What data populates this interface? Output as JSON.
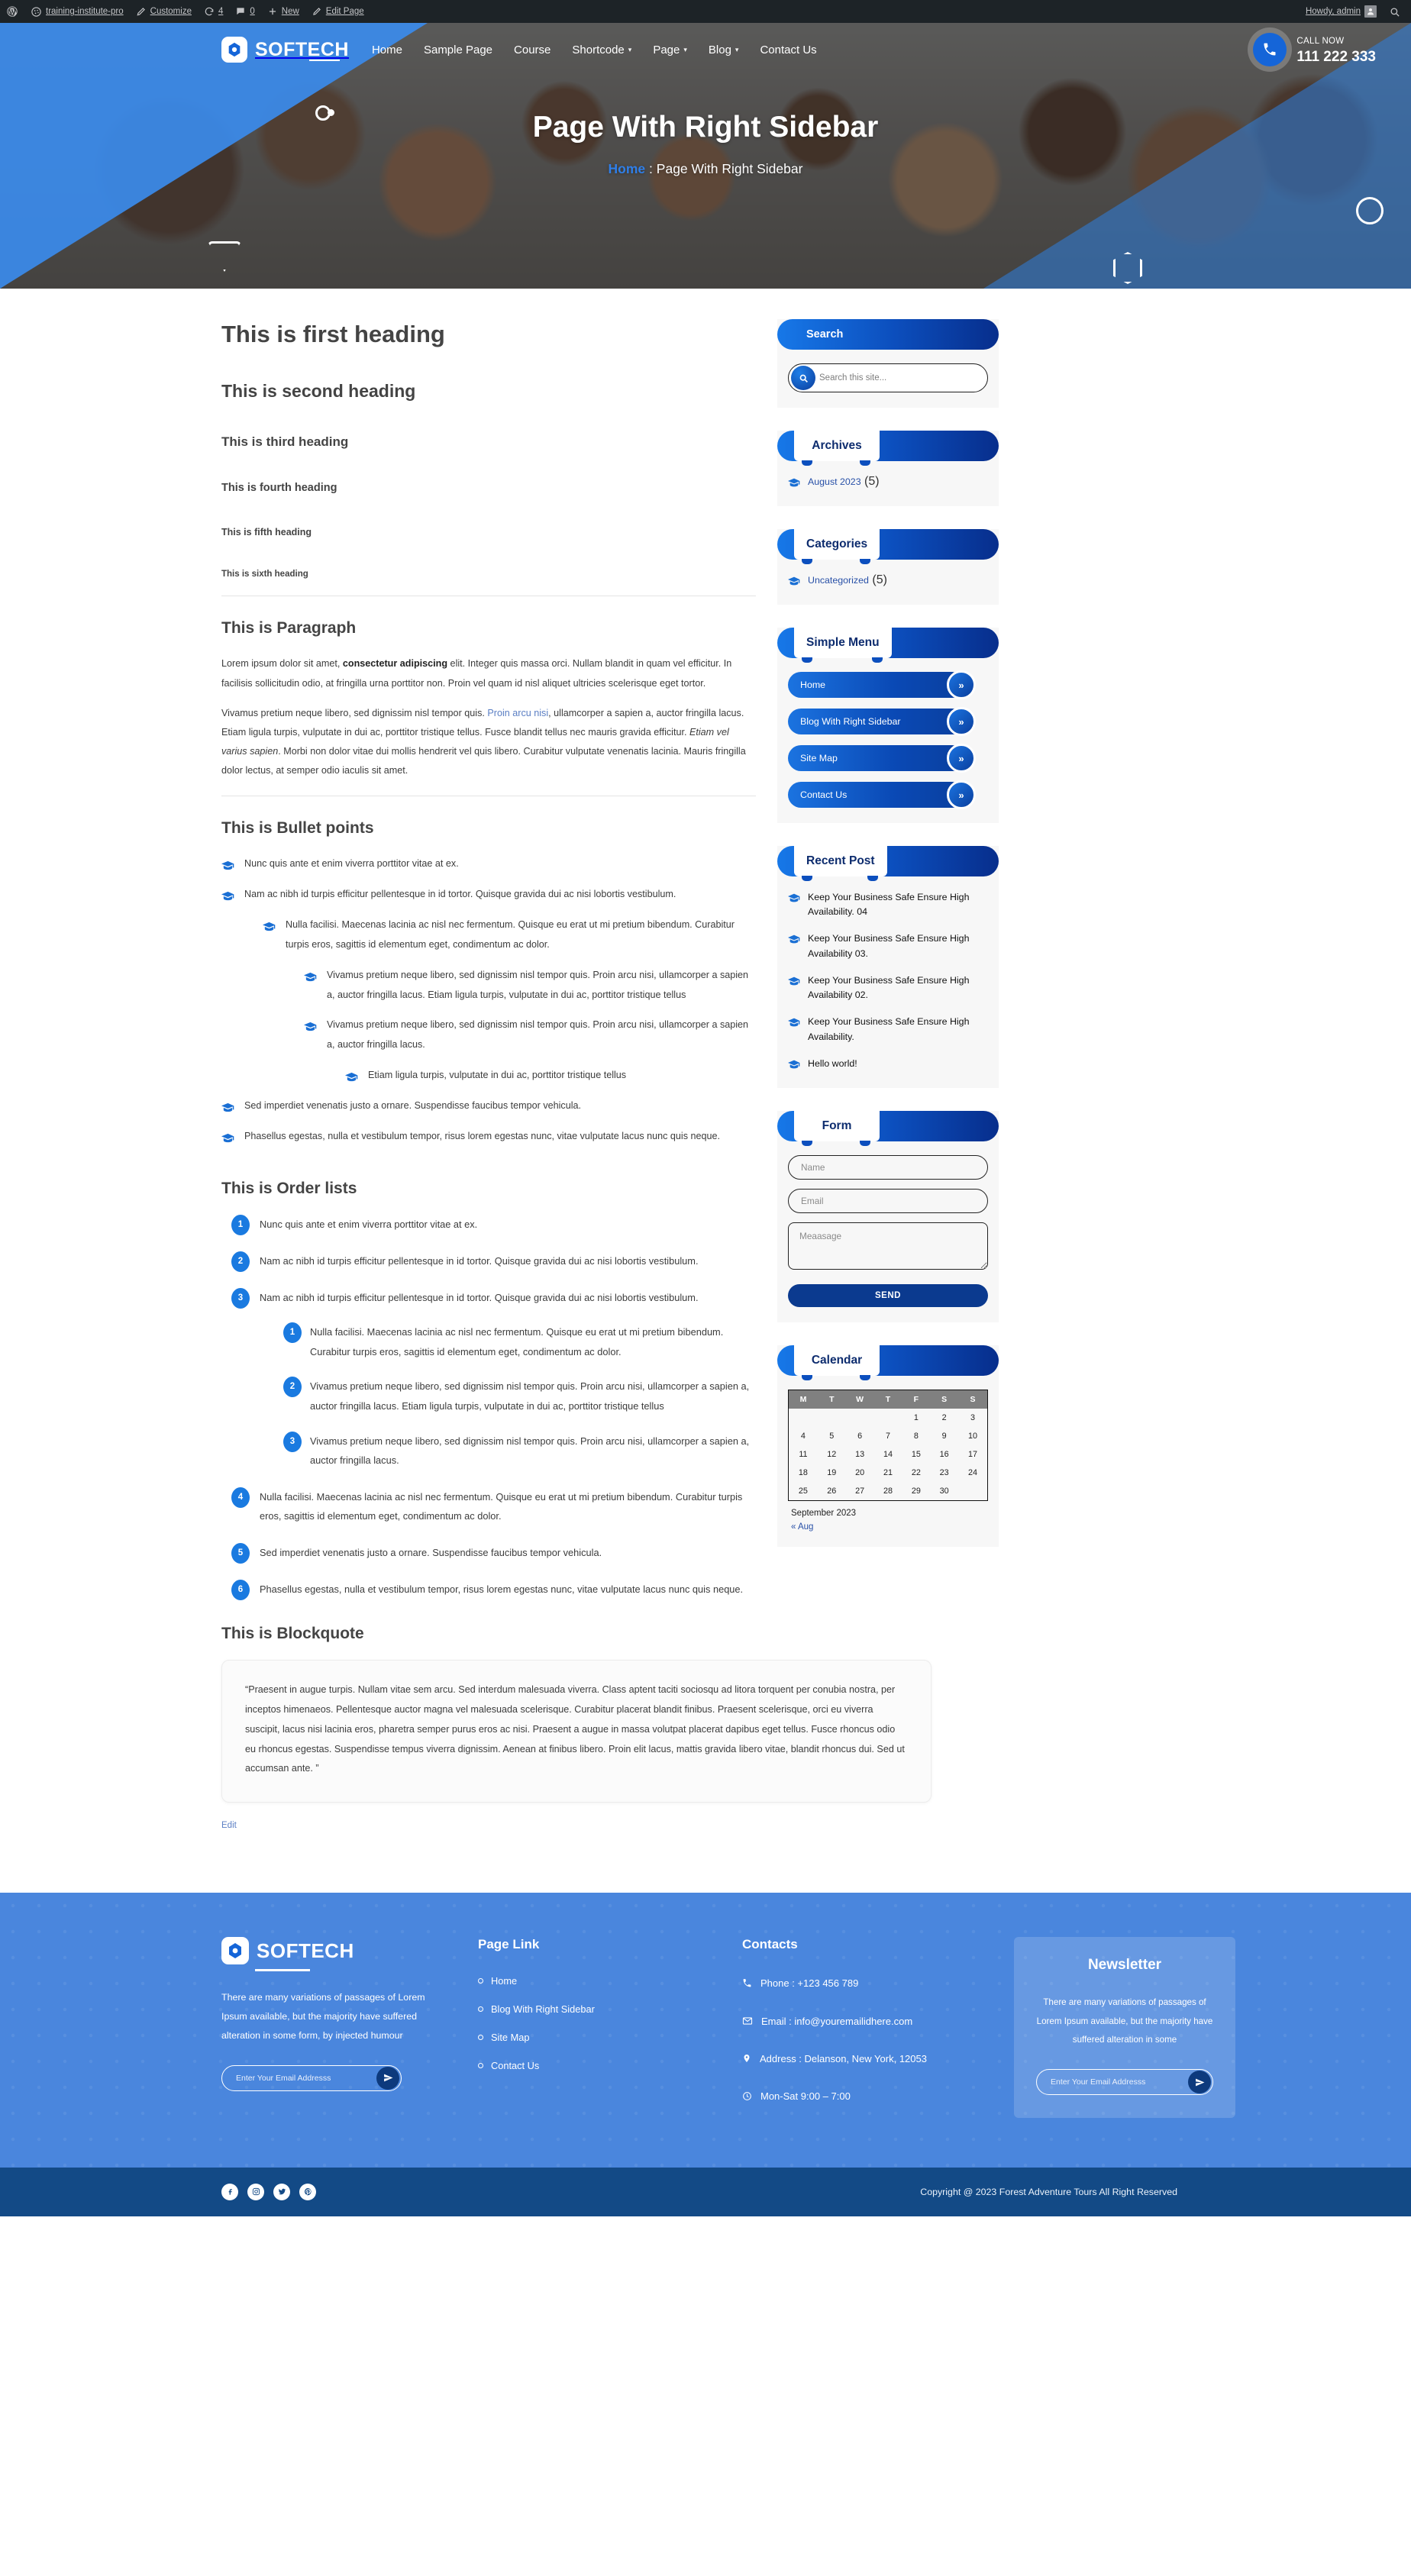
{
  "adminbar": {
    "wp_logo": "wordpress-icon",
    "site_name": "training-institute-pro",
    "customize": "Customize",
    "updates_count": "4",
    "comments_count": "0",
    "new": "New",
    "edit_page": "Edit Page",
    "howdy": "Howdy, admin",
    "search": "search-icon"
  },
  "header": {
    "brand": "SOFTECH",
    "nav": [
      {
        "label": "Home",
        "caret": false
      },
      {
        "label": "Sample Page",
        "caret": false
      },
      {
        "label": "Course",
        "caret": false
      },
      {
        "label": "Shortcode",
        "caret": true
      },
      {
        "label": "Page",
        "caret": true
      },
      {
        "label": "Blog",
        "caret": true
      },
      {
        "label": "Contact Us",
        "caret": false
      }
    ],
    "call_label": "CALL NOW",
    "call_number": "111 222 333",
    "hero_title": "Page With Right Sidebar",
    "crumb_home": "Home",
    "crumb_sep": ":",
    "crumb_current": "Page With Right Sidebar"
  },
  "content": {
    "headings": [
      "This is first heading",
      "This is second heading",
      "This is third heading",
      "This is fourth heading",
      "This is fifth heading",
      "This is sixth heading"
    ],
    "paragraph_title": "This is Paragraph",
    "p1_a": "Lorem ipsum dolor sit amet, ",
    "p1_b": "consectetur adipiscing",
    "p1_c": " elit. Integer quis massa orci. Nullam blandit in quam vel efficitur. In facilisis sollicitudin odio, at fringilla urna porttitor non. Proin vel quam id nisl aliquet ultricies scelerisque eget tortor.",
    "p2_a": "Vivamus pretium neque libero, sed dignissim nisl tempor quis. ",
    "p2_link": "Proin arcu nisi",
    "p2_b": ", ullamcorper a sapien a, auctor fringilla lacus. Etiam ligula turpis, vulputate in dui ac, porttitor tristique tellus. Fusce blandit tellus nec mauris gravida efficitur. ",
    "p2_i": "Etiam vel varius sapien",
    "p2_c": ". Morbi non dolor vitae dui mollis hendrerit vel quis libero. Curabitur vulputate venenatis lacinia. Mauris fringilla dolor lectus, at semper odio iaculis sit amet.",
    "bullet_title": "This is Bullet points",
    "bullets": {
      "b1": "Nunc quis ante et enim viverra porttitor vitae at ex.",
      "b2": "Nam ac nibh id turpis efficitur pellentesque in id tortor. Quisque gravida dui ac nisi lobortis vestibulum.",
      "b2_1": "Nulla facilisi. Maecenas lacinia ac nisl nec fermentum. Quisque eu erat ut mi pretium bibendum. Curabitur turpis eros, sagittis id elementum eget, condimentum ac dolor.",
      "b2_1_1": "Vivamus pretium neque libero, sed dignissim nisl tempor quis. Proin arcu nisi, ullamcorper a sapien a, auctor fringilla lacus. Etiam ligula turpis, vulputate in dui ac, porttitor tristique tellus",
      "b2_1_2": "Vivamus pretium neque libero, sed dignissim nisl tempor quis. Proin arcu nisi, ullamcorper a sapien a, auctor fringilla lacus.",
      "b2_1_2_1": "Etiam ligula turpis, vulputate in dui ac, porttitor tristique tellus",
      "b3": "Sed imperdiet venenatis justo a ornare. Suspendisse faucibus tempor vehicula.",
      "b4": "Phasellus egestas, nulla et vestibulum tempor, risus lorem egestas nunc, vitae vulputate lacus nunc quis neque."
    },
    "order_title": "This is Order lists",
    "orders": {
      "o1": "Nunc quis ante et enim viverra porttitor vitae at ex.",
      "o2": "Nam ac nibh id turpis efficitur pellentesque in id tortor. Quisque gravida dui ac nisi lobortis vestibulum.",
      "o3": "Nam ac nibh id turpis efficitur pellentesque in id tortor. Quisque gravida dui ac nisi lobortis vestibulum.",
      "o3_1": "Nulla facilisi. Maecenas lacinia ac nisl nec fermentum. Quisque eu erat ut mi pretium bibendum. Curabitur turpis eros, sagittis id elementum eget, condimentum ac dolor.",
      "o3_2": "Vivamus pretium neque libero, sed dignissim nisl tempor quis. Proin arcu nisi, ullamcorper a sapien a, auctor fringilla lacus. Etiam ligula turpis, vulputate in dui ac, porttitor tristique tellus",
      "o3_3": "Vivamus pretium neque libero, sed dignissim nisl tempor quis. Proin arcu nisi, ullamcorper a sapien a, auctor fringilla lacus.",
      "o4": "Nulla facilisi. Maecenas lacinia ac nisl nec fermentum. Quisque eu erat ut mi pretium bibendum. Curabitur turpis eros, sagittis id elementum eget, condimentum ac dolor.",
      "o5": "Sed imperdiet venenatis justo a ornare. Suspendisse faucibus tempor vehicula.",
      "o6": "Phasellus egestas, nulla et vestibulum tempor, risus lorem egestas nunc, vitae vulputate lacus nunc quis neque."
    },
    "blockquote_title": "This is Blockquote",
    "blockquote_text": "“Praesent in augue turpis. Nullam vitae sem arcu. Sed interdum malesuada viverra. Class aptent taciti sociosqu ad litora torquent per conubia nostra, per inceptos himenaeos. Pellentesque auctor magna vel malesuada scelerisque. Curabitur placerat blandit finibus. Praesent scelerisque, orci eu viverra suscipit, lacus nisi lacinia eros, pharetra semper purus eros ac nisi. Praesent a augue in massa volutpat placerat dapibus eget tellus. Fusce rhoncus odio eu rhoncus egestas. Suspendisse tempus viverra dignissim. Aenean at finibus libero. Proin elit lacus, mattis gravida libero vitae, blandit rhoncus dui. Sed ut accumsan ante. ”",
    "edit_link": "Edit"
  },
  "sidebar": {
    "search": {
      "title": "Search",
      "placeholder": "Search this site...",
      "icon": "search-icon"
    },
    "archives": {
      "title": "Archives",
      "items": [
        {
          "label": "August 2023",
          "count": "(5)"
        }
      ]
    },
    "categories": {
      "title": "Categories",
      "items": [
        {
          "label": "Uncategorized",
          "count": "(5)"
        }
      ]
    },
    "simple_menu": {
      "title": "Simple Menu",
      "items": [
        "Home",
        "Blog With Right Sidebar",
        "Site Map",
        "Contact Us"
      ]
    },
    "recent_post": {
      "title": "Recent Post",
      "items": [
        "Keep Your Business Safe Ensure High Availability. 04",
        "Keep Your Business Safe Ensure High Availability 03.",
        "Keep Your Business Safe Ensure High Availability 02.",
        "Keep Your Business Safe Ensure High Availability.",
        "Hello world!"
      ]
    },
    "form": {
      "title": "Form",
      "name_placeholder": "Name",
      "email_placeholder": "Email",
      "message_placeholder": "Meaasage",
      "send_label": "SEND"
    },
    "calendar": {
      "title": "Calendar",
      "weekdays": [
        "M",
        "T",
        "W",
        "T",
        "F",
        "S",
        "S"
      ],
      "weeks": [
        [
          "",
          "",
          "",
          "",
          "1",
          "2",
          "3"
        ],
        [
          "4",
          "5",
          "6",
          "7",
          "8",
          "9",
          "10"
        ],
        [
          "11",
          "12",
          "13",
          "14",
          "15",
          "16",
          "17"
        ],
        [
          "18",
          "19",
          "20",
          "21",
          "22",
          "23",
          "24"
        ],
        [
          "25",
          "26",
          "27",
          "28",
          "29",
          "30",
          ""
        ]
      ],
      "month_label": "September 2023",
      "prev_label": "« Aug"
    }
  },
  "footer": {
    "brand": "SOFTECH",
    "description": "There are many variations of passages of Lorem Ipsum available, but the majority have suffered alteration in some form, by injected humour",
    "email_placeholder": "Enter Your Email Addresss",
    "pagelink_title": "Page Link",
    "pagelinks": [
      "Home",
      "Blog With Right Sidebar",
      "Site Map",
      "Contact Us"
    ],
    "contacts_title": "Contacts",
    "contacts": [
      {
        "icon": "phone-icon",
        "text": "Phone : +123 456 789"
      },
      {
        "icon": "mail-icon",
        "text": "Email : info@youremailidhere.com"
      },
      {
        "icon": "location-pin-icon",
        "text": "Address : Delanson, New York, 12053"
      },
      {
        "icon": "clock-icon",
        "text": "Mon-Sat 9:00 – 7:00"
      }
    ],
    "newsletter_title": "Newsletter",
    "newsletter_desc": "There are many variations of passages of Lorem Ipsum available, but the majority have suffered alteration in some",
    "newsletter_placeholder": "Enter Your Email Addresss",
    "socials": [
      "facebook-icon",
      "instagram-icon",
      "twitter-icon",
      "pinterest-icon"
    ],
    "copyright": "Copyright @ 2023 Forest Adventure Tours All Right Reserved"
  },
  "colors": {
    "accent_blue": "#1a7ae0",
    "deep_blue": "#0b3a8f",
    "footer_blue": "#4a86dd",
    "bottom_blue": "#134a86"
  }
}
